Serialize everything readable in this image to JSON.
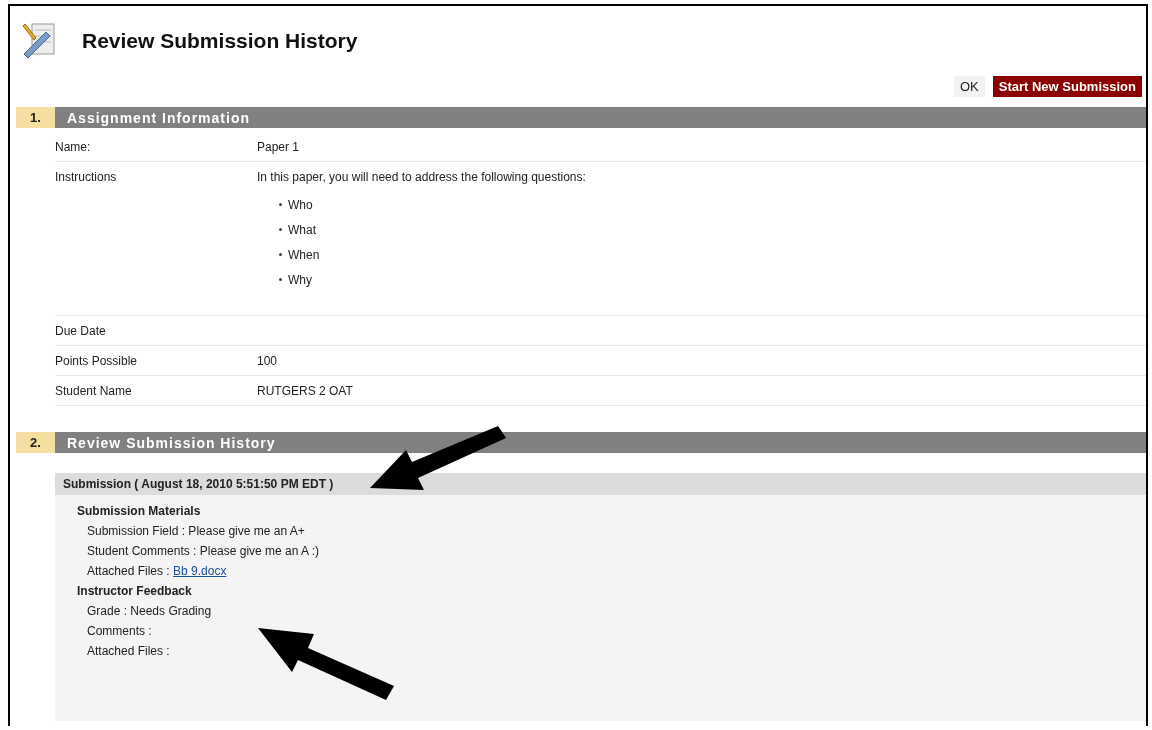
{
  "page": {
    "title": "Review Submission History"
  },
  "actions": [
    {
      "label": "OK",
      "kind": "plain"
    },
    {
      "label": "Start New Submission",
      "kind": "primary"
    }
  ],
  "sections": [
    {
      "number": "1.",
      "title": "Assignment Information",
      "kind": "info",
      "rows": [
        {
          "label": "Name:",
          "value": "Paper 1"
        },
        {
          "label": "Instructions",
          "value": "In this paper, you will need to address the following questions:",
          "bullets": [
            "Who",
            "What",
            "When",
            "Why"
          ]
        },
        {
          "label": "Due Date"
        },
        {
          "label": "Points Possible",
          "value": "100"
        },
        {
          "label": "Student Name",
          "value": "RUTGERS 2 OAT"
        }
      ]
    },
    {
      "number": "2.",
      "title": "Review Submission History",
      "kind": "history",
      "submission": {
        "heading": "Submission ( August 18, 2010 5:51:50 PM EDT )",
        "groups": [
          {
            "title": "Submission Materials",
            "lines": [
              {
                "label": "Submission Field : Please give me an A+"
              },
              {
                "label": "Student Comments : Please give me an A :)"
              },
              {
                "label": "Attached Files : ",
                "link": "Bb 9.docx"
              }
            ]
          },
          {
            "title": "Instructor Feedback",
            "lines": [
              {
                "label": "Grade : Needs Grading"
              },
              {
                "label": "Comments :"
              },
              {
                "label": "Attached Files :"
              }
            ]
          }
        ]
      }
    }
  ]
}
